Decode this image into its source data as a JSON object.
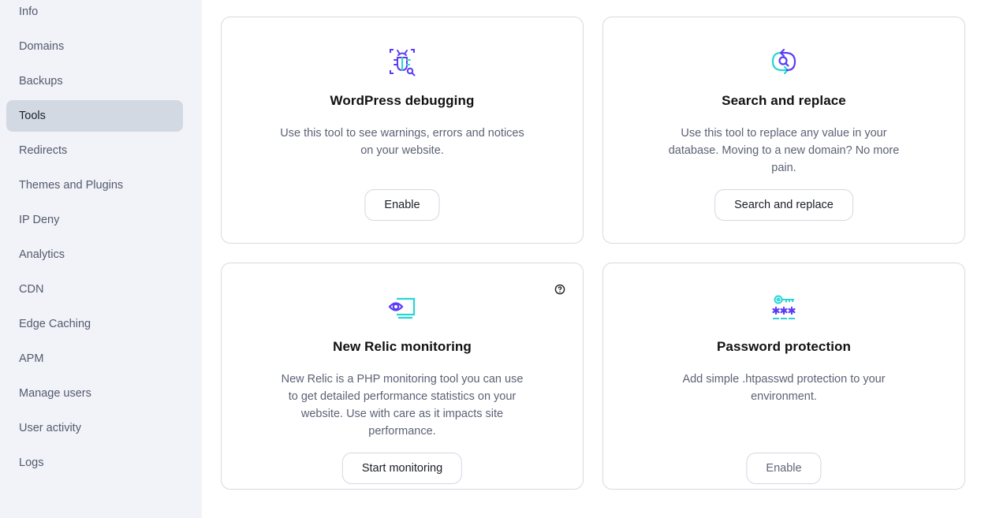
{
  "sidebar": {
    "items": [
      {
        "label": "Info",
        "active": false
      },
      {
        "label": "Domains",
        "active": false
      },
      {
        "label": "Backups",
        "active": false
      },
      {
        "label": "Tools",
        "active": true
      },
      {
        "label": "Redirects",
        "active": false
      },
      {
        "label": "Themes and Plugins",
        "active": false
      },
      {
        "label": "IP Deny",
        "active": false
      },
      {
        "label": "Analytics",
        "active": false
      },
      {
        "label": "CDN",
        "active": false
      },
      {
        "label": "Edge Caching",
        "active": false
      },
      {
        "label": "APM",
        "active": false
      },
      {
        "label": "Manage users",
        "active": false
      },
      {
        "label": "User activity",
        "active": false
      },
      {
        "label": "Logs",
        "active": false
      }
    ]
  },
  "tools": [
    {
      "icon": "bug-search-icon",
      "title": "WordPress debugging",
      "description": "Use this tool to see warnings, errors and notices on your website.",
      "button": "Enable"
    },
    {
      "icon": "search-replace-icon",
      "title": "Search and replace",
      "description": "Use this tool to replace any value in your database. Moving to a new domain? No more pain.",
      "button": "Search and replace"
    },
    {
      "icon": "eye-monitor-icon",
      "title": "New Relic monitoring",
      "description": "New Relic is a PHP monitoring tool you can use to get detailed performance statistics on your website. Use with care as it impacts site performance.",
      "button": "Start monitoring",
      "help_icon": "question-circle-icon"
    },
    {
      "icon": "key-password-icon",
      "title": "Password protection",
      "description": "Add simple .htpasswd protection to your environment.",
      "button": "Enable",
      "button_disabled": true
    }
  ],
  "colors": {
    "accent_purple": "#5b3cf5",
    "accent_teal": "#2bd4d4",
    "sidebar_bg": "#f1f3f8",
    "active_item_bg": "#d3d9e3"
  }
}
